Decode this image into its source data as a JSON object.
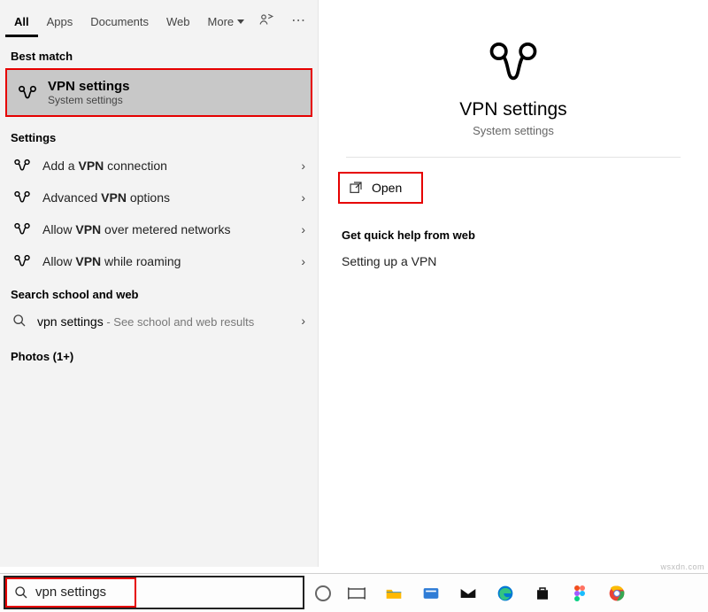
{
  "tabs": {
    "all": "All",
    "apps": "Apps",
    "documents": "Documents",
    "web": "Web",
    "more": "More"
  },
  "sections": {
    "best_match": "Best match",
    "settings": "Settings",
    "search_web": "Search school and web",
    "photos": "Photos (1+)"
  },
  "best_match": {
    "title": "VPN settings",
    "subtitle": "System settings"
  },
  "settings_items": {
    "0": {
      "pre": "Add a ",
      "bold": "VPN",
      "post": " connection"
    },
    "1": {
      "pre": "Advanced ",
      "bold": "VPN",
      "post": " options"
    },
    "2": {
      "pre": "Allow ",
      "bold": "VPN",
      "post": " over metered networks"
    },
    "3": {
      "pre": "Allow ",
      "bold": "VPN",
      "post": " while roaming"
    }
  },
  "web_suggestion": {
    "text": "vpn settings",
    "sub": " - See school and web results"
  },
  "preview": {
    "title": "VPN settings",
    "subtitle": "System settings",
    "open": "Open",
    "help_header": "Get quick help from web",
    "help_link": "Setting up a VPN"
  },
  "search": {
    "query": "vpn settings"
  },
  "highlight_color": "#e60000"
}
